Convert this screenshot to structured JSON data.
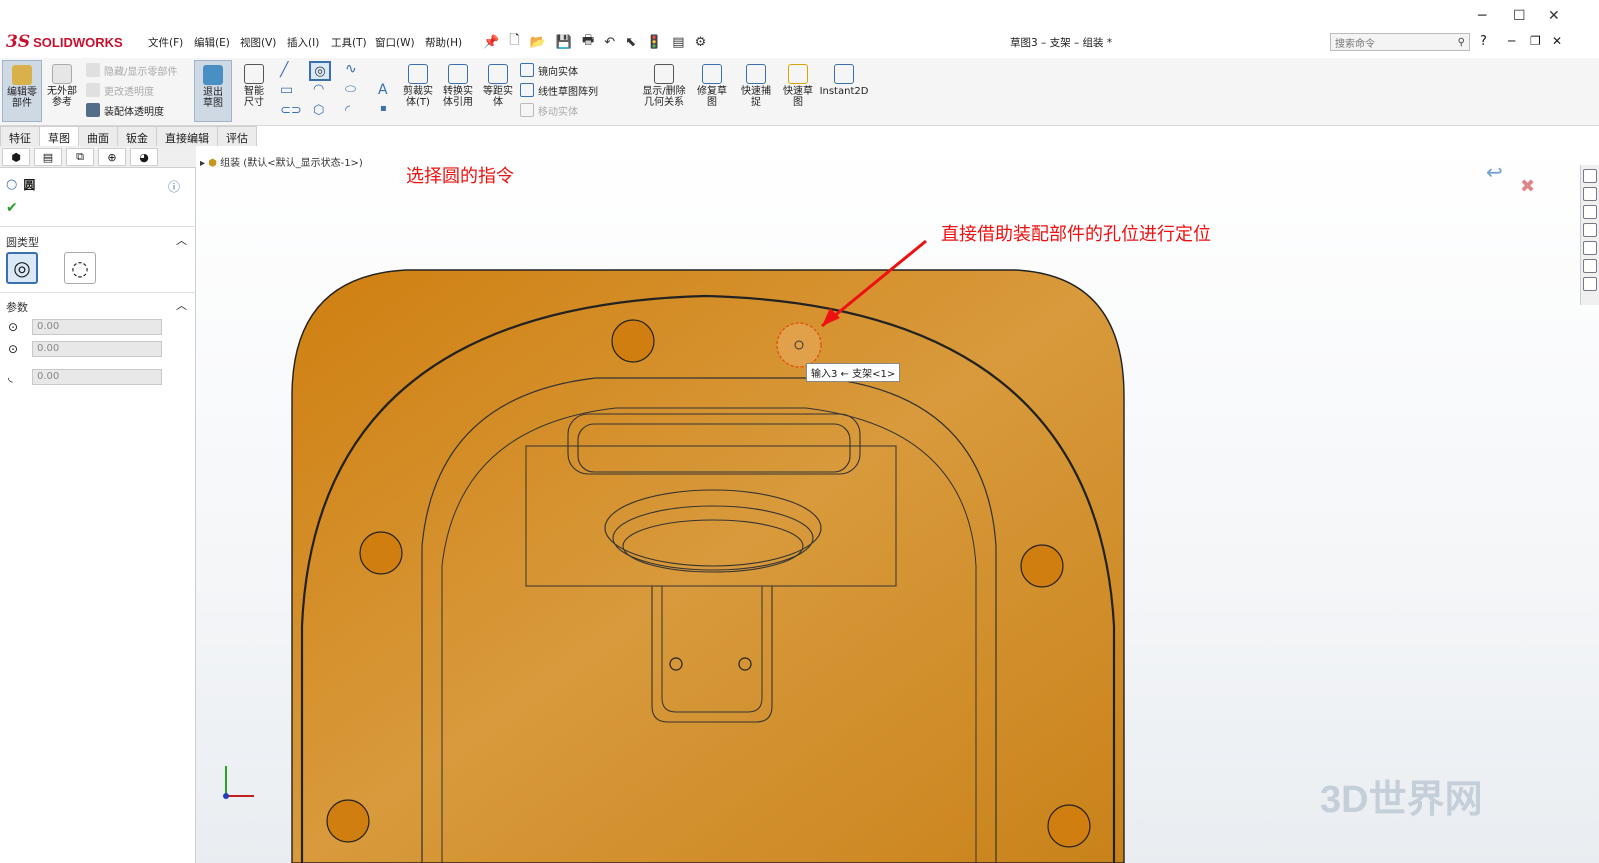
{
  "app": {
    "brand_ds": "3S",
    "brand_name": "SOLIDWORKS",
    "doc_title": "草图3 – 支架 – 组装 *"
  },
  "menu": [
    "文件(F)",
    "编辑(E)",
    "视图(V)",
    "插入(I)",
    "工具(T)",
    "窗口(W)",
    "帮助(H)"
  ],
  "search": {
    "placeholder": "搜索命令"
  },
  "ribbon": {
    "edit_part": "编辑零部件",
    "no_ext_ref": "无外部参考",
    "hide_show": "隐藏/显示零部件",
    "change_transparency": "更改透明度",
    "assembly_transparency": "装配体透明度",
    "exit_sketch": "退出草图",
    "smart_dim": "智能尺寸",
    "trim": "剪裁实体(T)",
    "convert": "转换实体引用",
    "offset": "等距实体",
    "mirror": "镜向实体",
    "linear_pattern": "线性草图阵列",
    "move": "移动实体",
    "show_relations": "显示/删除几何关系",
    "repair": "修复草图",
    "quick_snap": "快速捕捉",
    "rapid_sketch": "快速草图",
    "instant2d": "Instant2D"
  },
  "tabs": [
    "特征",
    "草图",
    "曲面",
    "钣金",
    "直接编辑",
    "评估"
  ],
  "active_tab": "草图",
  "property": {
    "title": "圆",
    "section_type": "圆类型",
    "section_params": "参数",
    "x": "0.00",
    "y": "0.00",
    "r": "0.00"
  },
  "tree": {
    "label": "组装 (默认<默认_显示状态-1>)"
  },
  "annotations": {
    "circle_cmd": "选择圆的指令",
    "locate_hole": "直接借助装配部件的孔位进行定位"
  },
  "tooltip": "输入3 ← 支架<1>",
  "watermark": "3D世界网",
  "colors": {
    "part": "#d6871a",
    "accent": "#c8102e",
    "annot": "#e11111"
  }
}
